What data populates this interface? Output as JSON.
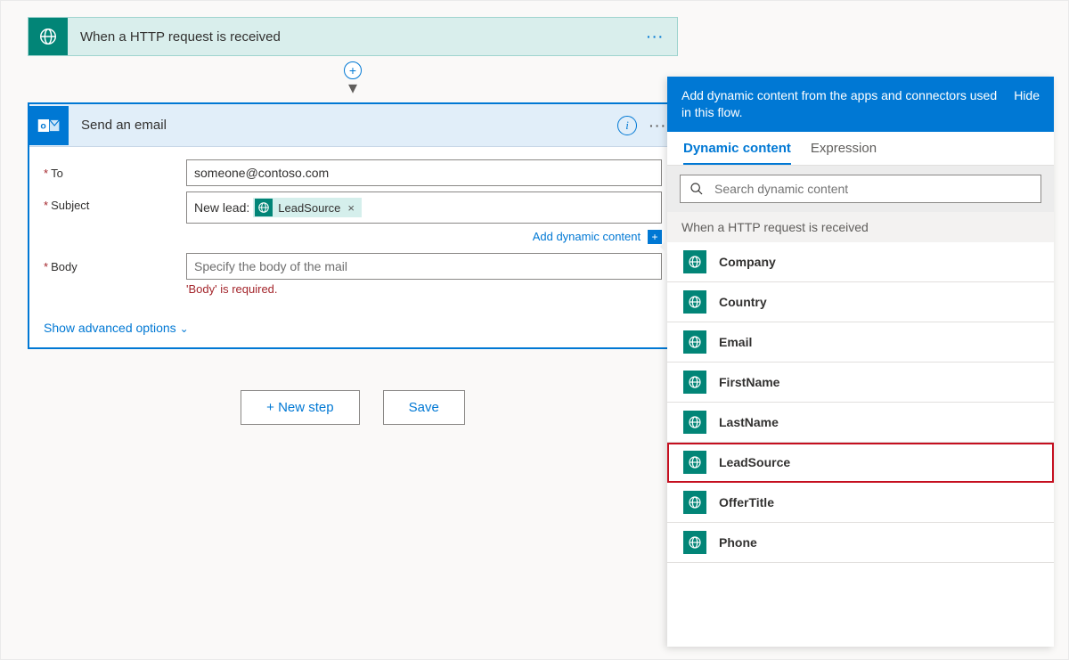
{
  "trigger": {
    "title": "When a HTTP request is received"
  },
  "action": {
    "title": "Send an email",
    "fields": {
      "to_label": "To",
      "to_value": "someone@contoso.com",
      "subject_label": "Subject",
      "subject_prefix": "New lead:",
      "subject_token": "LeadSource",
      "body_label": "Body",
      "body_placeholder": "Specify the body of the mail",
      "body_error": "'Body' is required."
    },
    "add_dynamic": "Add dynamic content",
    "advanced": "Show advanced options"
  },
  "buttons": {
    "new_step": "+ New step",
    "save": "Save"
  },
  "dynpanel": {
    "header": "Add dynamic content from the apps and connectors used in this flow.",
    "hide": "Hide",
    "tabs": {
      "dyn": "Dynamic content",
      "expr": "Expression"
    },
    "search_placeholder": "Search dynamic content",
    "group": "When a HTTP request is received",
    "items": [
      "Company",
      "Country",
      "Email",
      "FirstName",
      "LastName",
      "LeadSource",
      "OfferTitle",
      "Phone"
    ],
    "highlight": "LeadSource"
  }
}
